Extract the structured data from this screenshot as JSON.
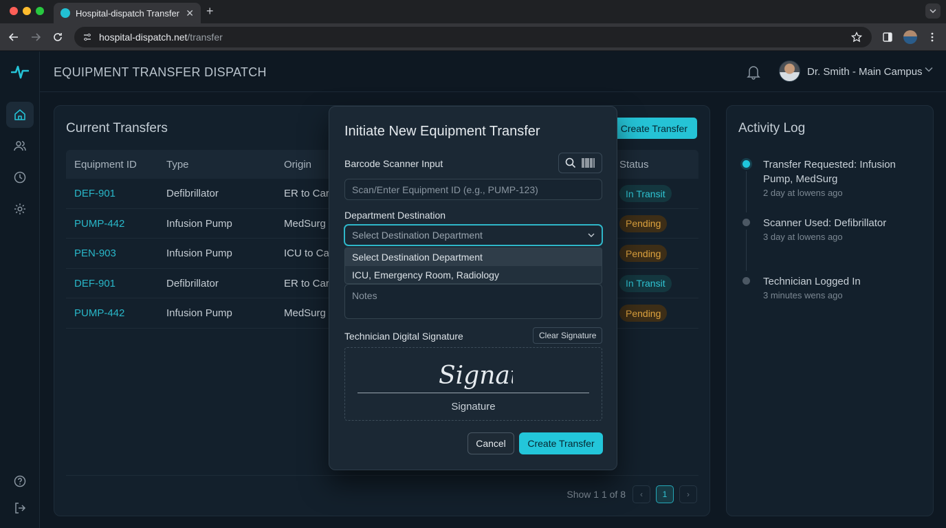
{
  "browser": {
    "tab_title": "Hospital-dispatch Transfer",
    "tab_close": "✕",
    "new_tab": "+",
    "url_domain": "hospital-dispatch.net",
    "url_path": "/transfer"
  },
  "header": {
    "title": "EQUIPMENT TRANSFER DISPATCH",
    "user_name": "Dr. Smith - Main Campus"
  },
  "sidebar": {
    "items": [
      "home-icon",
      "users-icon",
      "clock-icon",
      "settings-icon",
      "help-icon",
      "logout-icon"
    ]
  },
  "transfers": {
    "title": "Current Transfers",
    "create_label": "Create Transfer",
    "columns": [
      "Equipment ID",
      "Type",
      "Origin",
      "Status"
    ],
    "rows": [
      {
        "id": "DEF-901",
        "type": "Defibrillator",
        "origin": "ER to Card",
        "status": "In Transit"
      },
      {
        "id": "PUMP-442",
        "type": "Infusion Pump",
        "origin": "MedSurg t",
        "status": "Pending"
      },
      {
        "id": "PEN-903",
        "type": "Infusion Pump",
        "origin": "ICU to Car",
        "status": "Pending"
      },
      {
        "id": "DEF-901",
        "type": "Defibrillator",
        "origin": "ER to Card",
        "status": "In Transit"
      },
      {
        "id": "PUMP-442",
        "type": "Infusion Pump",
        "origin": "MedSurg t",
        "status": "Pending"
      }
    ],
    "pager": {
      "summary": "Show 1 1 of 8",
      "prev": "‹",
      "current": "1",
      "next": "›"
    }
  },
  "activity": {
    "title": "Activity Log",
    "items": [
      {
        "title": "Transfer Requested: Infusion Pump, MedSurg",
        "time": "2 day at lowens ago"
      },
      {
        "title": "Scanner Used: Defibrillator",
        "time": "3 day at lowens ago"
      },
      {
        "title": "Technician Logged In",
        "time": "3 minutes wens ago"
      }
    ]
  },
  "modal": {
    "title": "Initiate New Equipment Transfer",
    "scanner_label": "Barcode Scanner Input",
    "scanner_placeholder": "Scan/Enter Equipment ID (e.g., PUMP-123)",
    "dest_label": "Department Destination",
    "dest_value": "Select Destination Department",
    "dest_options": [
      "Select Destination Department",
      "ICU, Emergency Room, Radiology"
    ],
    "notes_placeholder": "Notes",
    "signature_label": "Technician Digital Signature",
    "clear_label": "Clear Signature",
    "signature_script": "Signature",
    "signature_caption": "Signature",
    "cancel_label": "Cancel",
    "create_label": "Create Transfer"
  },
  "colors": {
    "accent": "#23c6da",
    "pending": "#e0a43f",
    "background": "#0e1822"
  }
}
